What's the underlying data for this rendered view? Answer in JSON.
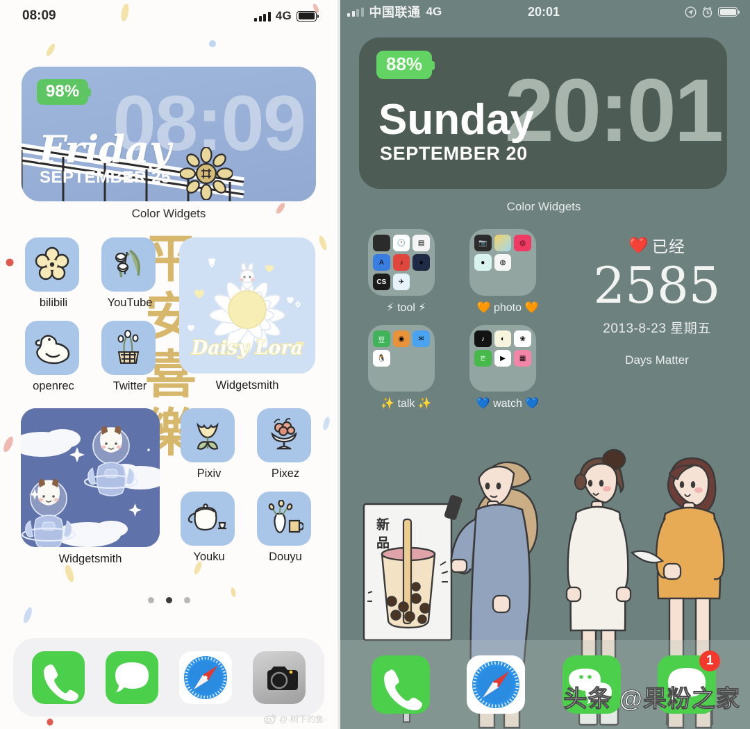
{
  "left_phone": {
    "status_bar": {
      "time": "08:09",
      "network": "4G",
      "signal_icon": "signal-bars-icon",
      "battery_icon": "battery-icon"
    },
    "clock_widget": {
      "battery_badge": "98%",
      "time": "08:09",
      "day_name": "Friday",
      "date": "SEPTEMBER 25",
      "label": "Color Widgets",
      "background_color": "#9fb7dc",
      "badge_color": "#5dc561"
    },
    "wallpaper_text": "平安喜樂",
    "wallpaper_text_color": "#d6b464",
    "apps": [
      {
        "name": "bilibili",
        "icon": "flower-icon"
      },
      {
        "name": "YouTube",
        "icon": "lily-of-the-valley-icon"
      },
      {
        "name": "openrec",
        "icon": "duck-icon"
      },
      {
        "name": "Twitter",
        "icon": "flower-basket-icon"
      },
      {
        "name": "Pixiv",
        "icon": "tulip-icon"
      },
      {
        "name": "Pixez",
        "icon": "fruit-bowl-icon"
      },
      {
        "name": "Youku",
        "icon": "teapot-icon"
      },
      {
        "name": "Douyu",
        "icon": "vase-and-mug-icon"
      }
    ],
    "widgets": [
      {
        "name": "Widgetsmith",
        "art": "daisy-flower",
        "caption": "Daisy Lora"
      },
      {
        "name": "Widgetsmith",
        "art": "astronaut-sheep"
      }
    ],
    "page_dots": {
      "count": 3,
      "active_index": 1
    },
    "dock": [
      {
        "name": "Phone",
        "icon": "phone-icon"
      },
      {
        "name": "Messages",
        "icon": "message-bubble-icon"
      },
      {
        "name": "Safari",
        "icon": "compass-icon"
      },
      {
        "name": "Camera",
        "icon": "camera-icon"
      }
    ],
    "watermark": "@·树下的鱼·"
  },
  "right_phone": {
    "status_bar": {
      "carrier": "中国联通",
      "network": "4G",
      "time": "20:01",
      "icons": [
        "location-arrow-icon",
        "alarm-clock-icon",
        "battery-icon"
      ]
    },
    "clock_widget": {
      "battery_badge": "88%",
      "time": "20:01",
      "day_name": "Sunday",
      "date": "SEPTEMBER 20",
      "label": "Color Widgets",
      "background_color": "#4e5c56",
      "time_color": "#a7b5ac",
      "badge_color": "#63d463"
    },
    "folders": [
      {
        "label": "⚡ tool ⚡"
      },
      {
        "label": "🧡 photo 🧡"
      },
      {
        "label": "✨ talk ✨"
      },
      {
        "label": "💙 watch 💙"
      }
    ],
    "days_matter": {
      "heart": "❤️",
      "title": "已经",
      "count": "2585",
      "date": "2013-8-23 星期五",
      "label": "Days Matter"
    },
    "wallpaper": "three-girls-bubble-tea-illustration",
    "wallpaper_sign_text": "新品",
    "background_color": "#6d817f",
    "dock": [
      {
        "name": "Phone",
        "icon": "phone-icon",
        "badge": ""
      },
      {
        "name": "Safari",
        "icon": "compass-icon",
        "badge": ""
      },
      {
        "name": "WeChat",
        "icon": "wechat-icon",
        "badge": ""
      },
      {
        "name": "Messages",
        "icon": "message-bubble-icon",
        "badge": "1"
      }
    ],
    "watermark": "头条 @果粉之家"
  }
}
